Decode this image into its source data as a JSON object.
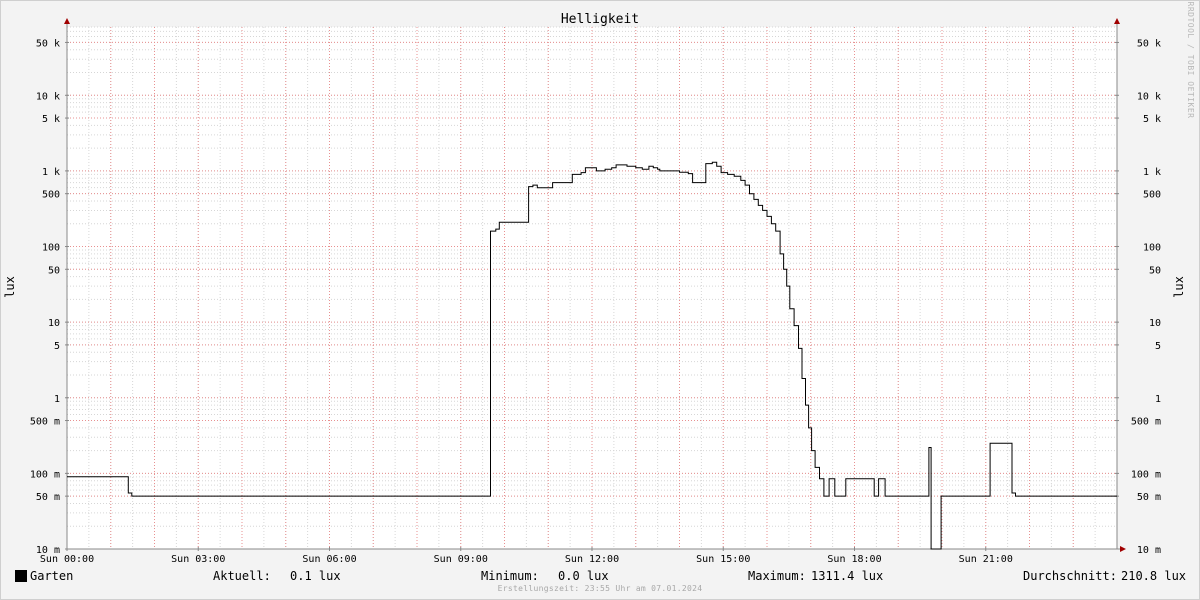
{
  "chart_data": {
    "type": "line",
    "title": "Helligkeit",
    "ylabel": "lux",
    "y_scale": "log",
    "ylim": [
      0.01,
      80000
    ],
    "xlim": [
      0,
      24
    ],
    "grid": true,
    "colors": {
      "background": "#f3f3f3",
      "plot": "#ffffff",
      "minor_grid": "#d6d6d6",
      "major_grid": "#e89090",
      "line": "#000000",
      "axis_arrow": "#a00000"
    },
    "x_ticks": [
      {
        "value": 0,
        "label": "Sun 00:00"
      },
      {
        "value": 3,
        "label": "Sun 03:00"
      },
      {
        "value": 6,
        "label": "Sun 06:00"
      },
      {
        "value": 9,
        "label": "Sun 09:00"
      },
      {
        "value": 12,
        "label": "Sun 12:00"
      },
      {
        "value": 15,
        "label": "Sun 15:00"
      },
      {
        "value": 18,
        "label": "Sun 18:00"
      },
      {
        "value": 21,
        "label": "Sun 21:00"
      }
    ],
    "y_ticks": [
      {
        "value": 0.01,
        "label": "10 m"
      },
      {
        "value": 0.05,
        "label": "50 m"
      },
      {
        "value": 0.1,
        "label": "100 m"
      },
      {
        "value": 0.5,
        "label": "500 m"
      },
      {
        "value": 1,
        "label": "1"
      },
      {
        "value": 5,
        "label": "5"
      },
      {
        "value": 10,
        "label": "10"
      },
      {
        "value": 50,
        "label": "50"
      },
      {
        "value": 100,
        "label": "100"
      },
      {
        "value": 500,
        "label": "500"
      },
      {
        "value": 1000,
        "label": "1 k"
      },
      {
        "value": 5000,
        "label": "5 k"
      },
      {
        "value": 10000,
        "label": "10 k"
      },
      {
        "value": 50000,
        "label": "50 k"
      }
    ],
    "series": [
      {
        "name": "Garten",
        "color": "#000000",
        "points": [
          [
            0,
            0.09
          ],
          [
            1.38,
            0.09
          ],
          [
            1.4,
            0.055
          ],
          [
            1.48,
            0.05
          ],
          [
            9.65,
            0.05
          ],
          [
            9.68,
            160
          ],
          [
            9.8,
            170
          ],
          [
            9.88,
            210
          ],
          [
            10.5,
            210
          ],
          [
            10.55,
            620
          ],
          [
            10.65,
            650
          ],
          [
            10.75,
            600
          ],
          [
            11.05,
            600
          ],
          [
            11.1,
            700
          ],
          [
            11.5,
            700
          ],
          [
            11.55,
            900
          ],
          [
            11.75,
            950
          ],
          [
            11.85,
            1100
          ],
          [
            12.05,
            1100
          ],
          [
            12.1,
            1000
          ],
          [
            12.3,
            1050
          ],
          [
            12.45,
            1100
          ],
          [
            12.55,
            1200
          ],
          [
            12.8,
            1150
          ],
          [
            13.0,
            1100
          ],
          [
            13.15,
            1050
          ],
          [
            13.3,
            1150
          ],
          [
            13.4,
            1100
          ],
          [
            13.5,
            1050
          ],
          [
            13.55,
            1000
          ],
          [
            13.9,
            1000
          ],
          [
            14.0,
            960
          ],
          [
            14.2,
            920
          ],
          [
            14.3,
            700
          ],
          [
            14.58,
            700
          ],
          [
            14.6,
            1250
          ],
          [
            14.75,
            1300
          ],
          [
            14.85,
            1150
          ],
          [
            14.95,
            950
          ],
          [
            15.1,
            900
          ],
          [
            15.25,
            850
          ],
          [
            15.4,
            750
          ],
          [
            15.5,
            650
          ],
          [
            15.6,
            500
          ],
          [
            15.7,
            420
          ],
          [
            15.8,
            350
          ],
          [
            15.9,
            300
          ],
          [
            16.0,
            250
          ],
          [
            16.1,
            200
          ],
          [
            16.2,
            160
          ],
          [
            16.3,
            80
          ],
          [
            16.38,
            50
          ],
          [
            16.45,
            30
          ],
          [
            16.52,
            15
          ],
          [
            16.62,
            9
          ],
          [
            16.72,
            4.5
          ],
          [
            16.8,
            1.8
          ],
          [
            16.88,
            0.8
          ],
          [
            16.95,
            0.4
          ],
          [
            17.02,
            0.2
          ],
          [
            17.1,
            0.12
          ],
          [
            17.2,
            0.085
          ],
          [
            17.3,
            0.05
          ],
          [
            17.38,
            0.05
          ],
          [
            17.42,
            0.085
          ],
          [
            17.5,
            0.085
          ],
          [
            17.55,
            0.05
          ],
          [
            17.75,
            0.05
          ],
          [
            17.8,
            0.085
          ],
          [
            18.4,
            0.085
          ],
          [
            18.45,
            0.05
          ],
          [
            18.5,
            0.05
          ],
          [
            18.55,
            0.085
          ],
          [
            18.65,
            0.085
          ],
          [
            18.7,
            0.05
          ],
          [
            19.65,
            0.05
          ],
          [
            19.7,
            0.22
          ],
          [
            19.75,
            0.01
          ],
          [
            19.92,
            0.01
          ],
          [
            19.98,
            0.05
          ],
          [
            21.05,
            0.05
          ],
          [
            21.1,
            0.25
          ],
          [
            21.55,
            0.25
          ],
          [
            21.6,
            0.055
          ],
          [
            21.68,
            0.05
          ],
          [
            24,
            0.05
          ]
        ]
      }
    ]
  },
  "legend": {
    "series_name": "Garten",
    "aktuell_label": "Aktuell:",
    "aktuell_value": "0.1 lux",
    "minimum_label": "Minimum:",
    "minimum_value": "0.0 lux",
    "maximum_label": "Maximum:",
    "maximum_value": "1311.4 lux",
    "durchschnitt_label": "Durchschnitt:",
    "durchschnitt_value": "210.8 lux"
  },
  "footer": "Erstellungszeit: 23:55 Uhr am 07.01.2024",
  "vendor_text": "RRDTOOL / TOBI OETIKER"
}
